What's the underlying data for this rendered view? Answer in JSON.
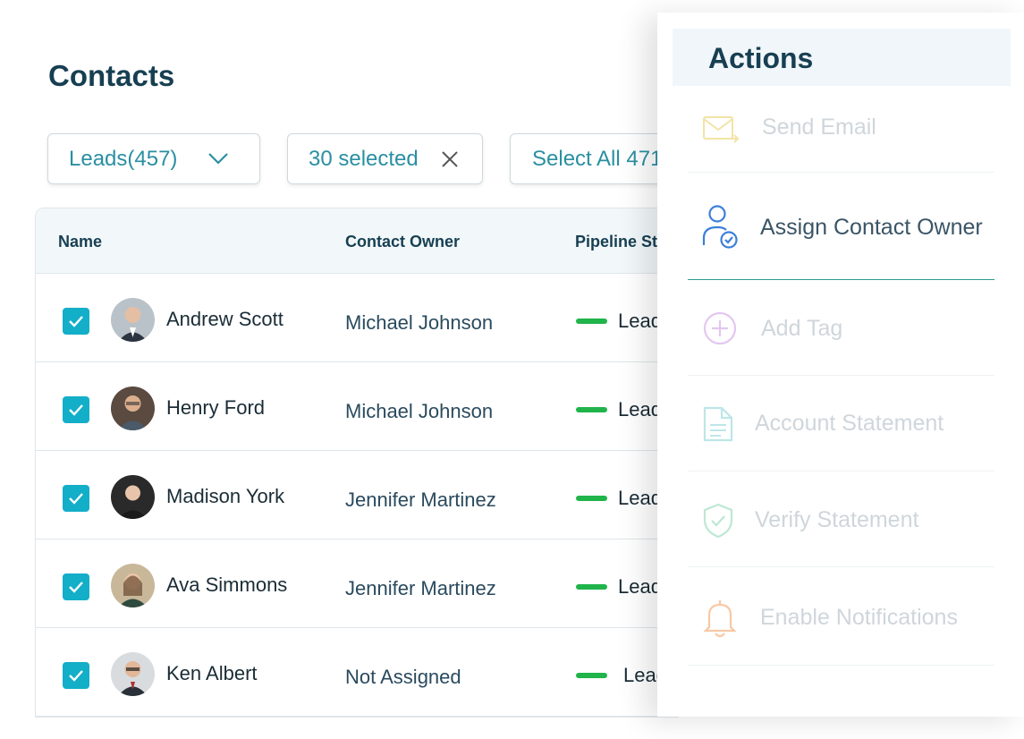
{
  "page": {
    "title": "Contacts"
  },
  "filters": {
    "leads_label": "Leads(457)",
    "selected_label": "30 selected",
    "select_all_label": "Select All 471"
  },
  "table": {
    "headers": {
      "name": "Name",
      "owner": "Contact Owner",
      "stage": "Pipeline Stage"
    },
    "rows": [
      {
        "name": "Andrew Scott",
        "owner": "Michael Johnson",
        "stage": "Lead",
        "checked": true
      },
      {
        "name": "Henry Ford",
        "owner": "Michael Johnson",
        "stage": "Lead",
        "checked": true
      },
      {
        "name": "Madison York",
        "owner": "Jennifer Martinez",
        "stage": "Lead",
        "checked": true
      },
      {
        "name": "Ava Simmons",
        "owner": "Jennifer Martinez",
        "stage": "Lead",
        "checked": true
      },
      {
        "name": "Ken Albert",
        "owner": "Not Assigned",
        "stage": "Lead",
        "checked": true
      }
    ]
  },
  "actions_panel": {
    "title": "Actions",
    "items": [
      {
        "label": "Send Email",
        "icon": "mail-send-icon",
        "color": "#f3e3a6",
        "text_color": "#cfd6db"
      },
      {
        "label": "Assign Contact Owner",
        "icon": "user-check-icon",
        "color": "#3d7fd9",
        "text_color": "#3a5566",
        "active": true
      },
      {
        "label": "Add Tag",
        "icon": "plus-circle-icon",
        "color": "#e3c7f2",
        "text_color": "#cfd6db"
      },
      {
        "label": "Account Statement",
        "icon": "document-icon",
        "color": "#bde6e8",
        "text_color": "#cfd6db"
      },
      {
        "label": "Verify Statement",
        "icon": "shield-check-icon",
        "color": "#bde8d4",
        "text_color": "#cfd6db"
      },
      {
        "label": "Enable Notifications",
        "icon": "bell-icon",
        "color": "#f7c8a4",
        "text_color": "#cfd6db"
      }
    ]
  },
  "colors": {
    "accent": "#13aec8",
    "pipeline_green": "#20b44b",
    "title": "#173f52"
  }
}
